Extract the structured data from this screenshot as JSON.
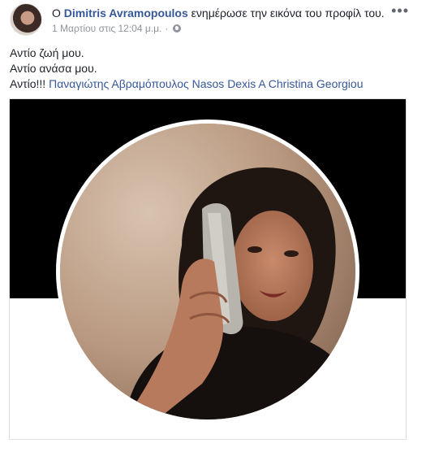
{
  "post": {
    "author_prefix": "O",
    "author_name": "Dimitris Avramopoulos",
    "action": "ενημέρωσε την εικόνα του προφίλ του.",
    "timestamp": "1 Μαρτίου στις 12:04 μ.μ.",
    "separator": "·",
    "privacy_icon": "globe-icon",
    "more_icon": "more-options-icon",
    "more_glyph": "•••",
    "lines": [
      "Αντίο ζωή μου.",
      "Αντίο ανάσα μου."
    ],
    "line3_text": "Αντίο!!!",
    "tagged": "Παναγιώτης Αβραμόπουλος Nasos Dexis A Christina Georgiou"
  },
  "colors": {
    "link": "#365899",
    "meta": "#90949c",
    "text": "#1d2129",
    "cover": "#000000"
  }
}
